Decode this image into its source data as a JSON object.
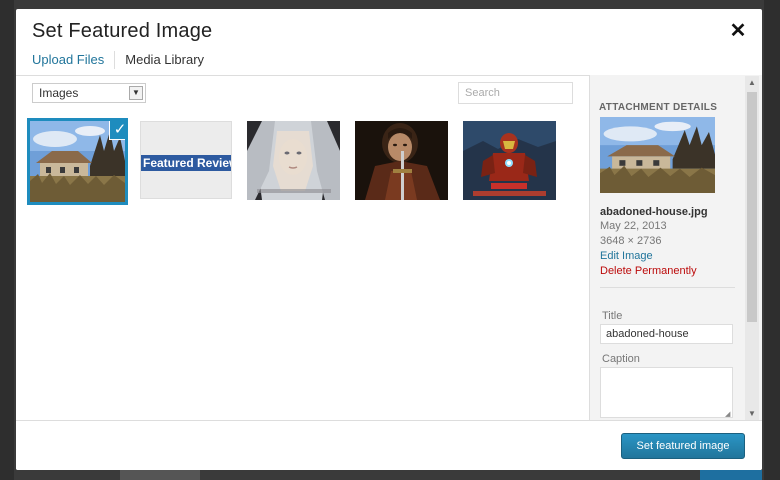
{
  "modal": {
    "title": "Set Featured Image",
    "close_icon": "close-icon"
  },
  "tabs": [
    {
      "label": "Upload Files",
      "active": false
    },
    {
      "label": "Media Library",
      "active": true
    }
  ],
  "toolbar": {
    "filter_selected": "Images",
    "search_placeholder": "Search"
  },
  "grid": {
    "items": [
      {
        "name": "abandoned-house",
        "selected": true
      },
      {
        "name": "featured-review-banner",
        "text": "Featured Review",
        "selected": false
      },
      {
        "name": "blonde-girl-portrait",
        "selected": false
      },
      {
        "name": "sword-man-portrait",
        "selected": false
      },
      {
        "name": "iron-man-poster",
        "selected": false
      }
    ]
  },
  "sidebar": {
    "heading": "ATTACHMENT DETAILS",
    "filename": "abadoned-house.jpg",
    "date": "May 22, 2013",
    "dimensions": "3648 × 2736",
    "edit_link": "Edit Image",
    "delete_link": "Delete Permanently",
    "title_label": "Title",
    "title_value": "abadoned-house",
    "caption_label": "Caption",
    "caption_value": ""
  },
  "footer": {
    "primary_button": "Set featured image"
  },
  "colors": {
    "accent": "#21759b",
    "selection": "#1e8cbe",
    "danger": "#bc0b0b"
  }
}
